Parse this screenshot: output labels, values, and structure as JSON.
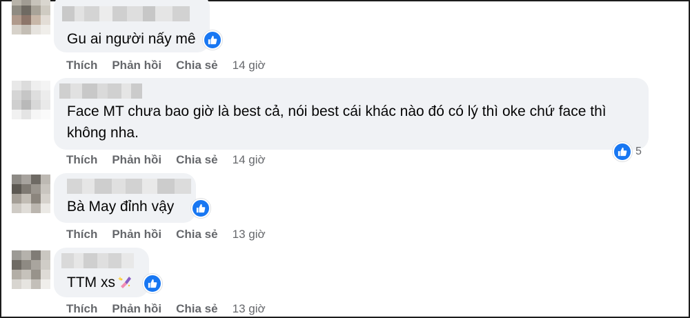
{
  "actions": {
    "like": "Thích",
    "reply": "Phản hồi",
    "share": "Chia sẻ"
  },
  "comments": [
    {
      "text": "Gu ai người nấy mê",
      "time": "14 giờ",
      "reaction_count": ""
    },
    {
      "text_line1": "Face MT chưa bao giờ là best cả, nói best cái khác nào đó có lý thì oke chứ face thì",
      "text_line2": "không nha.",
      "time": "14 giờ",
      "reaction_count": "5"
    },
    {
      "text": "Bà May đỉnh vậy",
      "time": "13 giờ",
      "reaction_count": ""
    },
    {
      "text": "TTM xs",
      "time": "13 giờ",
      "reaction_count": "",
      "emoji": "nail-polish-icon"
    }
  ],
  "colors": {
    "bubble": "#f0f2f5",
    "action_text": "#65676b",
    "like_blue": "#1877f2"
  }
}
